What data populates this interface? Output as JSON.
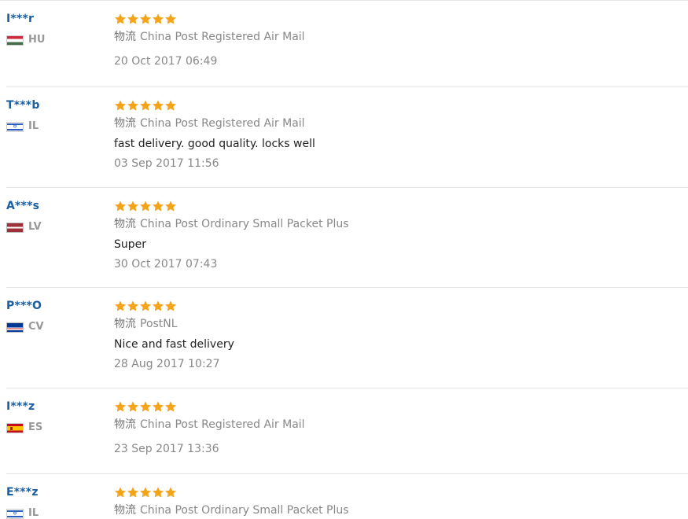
{
  "colors": {
    "username": "#1a5fa0",
    "star": "#f5a31a",
    "muted": "#888888",
    "comment": "#222222"
  },
  "logistics_prefix": "物流",
  "reviews": [
    {
      "user": "I***r",
      "country": "HU",
      "flag_icon": "hungary-flag-icon",
      "rating": 5,
      "logistics": "China Post Registered Air Mail",
      "comment": "",
      "date": "20 Oct 2017 06:49"
    },
    {
      "user": "T***b",
      "country": "IL",
      "flag_icon": "israel-flag-icon",
      "rating": 5,
      "logistics": "China Post Registered Air Mail",
      "comment": "fast delivery. good quality. locks well",
      "date": "03 Sep 2017 11:56"
    },
    {
      "user": "A***s",
      "country": "LV",
      "flag_icon": "latvia-flag-icon",
      "rating": 5,
      "logistics": "China Post Ordinary Small Packet Plus",
      "comment": "Super",
      "date": "30 Oct 2017 07:43"
    },
    {
      "user": "P***O",
      "country": "CV",
      "flag_icon": "cape-verde-flag-icon",
      "rating": 5,
      "logistics": "PostNL",
      "comment": "Nice and fast delivery",
      "date": "28 Aug 2017 10:27"
    },
    {
      "user": "I***z",
      "country": "ES",
      "flag_icon": "spain-flag-icon",
      "rating": 5,
      "logistics": "China Post Registered Air Mail",
      "comment": "",
      "date": "23 Sep 2017 13:36"
    },
    {
      "user": "E***z",
      "country": "IL",
      "flag_icon": "israel-flag-icon",
      "rating": 5,
      "logistics": "China Post Ordinary Small Packet Plus",
      "comment": "",
      "date": ""
    }
  ]
}
